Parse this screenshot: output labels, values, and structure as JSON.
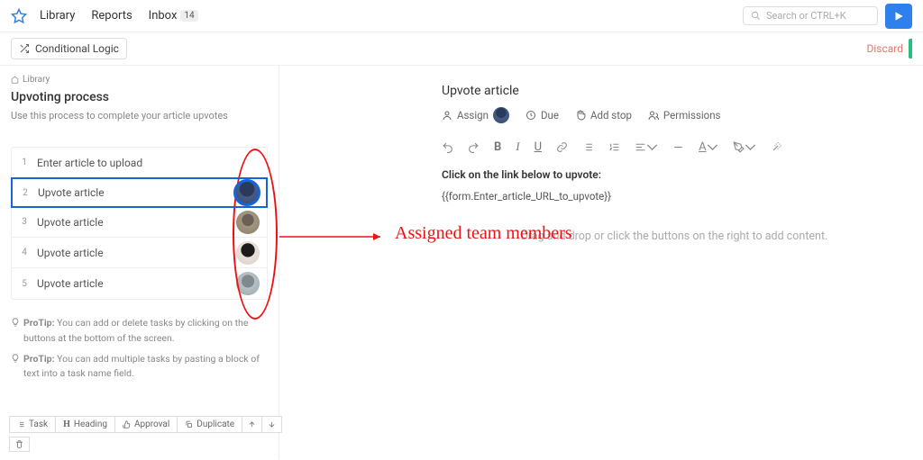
{
  "nav": {
    "items": [
      "Library",
      "Reports",
      "Inbox"
    ],
    "inbox_badge": "14",
    "search_placeholder": "Search or CTRL+K"
  },
  "toolbar": {
    "conditional_logic": "Conditional Logic",
    "discard": "Discard"
  },
  "breadcrumb": {
    "root": "Library"
  },
  "process": {
    "title": "Upvoting process",
    "subtitle": "Use this process to complete your article upvotes"
  },
  "tasks": [
    {
      "num": "1",
      "name": "Enter article to upload",
      "avatar": ""
    },
    {
      "num": "2",
      "name": "Upvote article",
      "avatar": "a1",
      "selected": true
    },
    {
      "num": "3",
      "name": "Upvote article",
      "avatar": "a2"
    },
    {
      "num": "4",
      "name": "Upvote article",
      "avatar": "a3"
    },
    {
      "num": "5",
      "name": "Upvote article",
      "avatar": "a4"
    }
  ],
  "tips": {
    "label": "ProTip:",
    "t1": "You can add or delete tasks by clicking on the buttons at the bottom of the screen.",
    "t2": "You can add multiple tasks by pasting a block of text into a task name field."
  },
  "bottom_buttons": {
    "task": "Task",
    "heading": "Heading",
    "approval": "Approval",
    "duplicate": "Duplicate"
  },
  "detail": {
    "title": "Upvote article",
    "assign": "Assign",
    "due": "Due",
    "add_stop": "Add stop",
    "permissions": "Permissions",
    "body_heading": "Click on the link below to upvote:",
    "body_template": "{{form.Enter_article_URL_to_upvote}}",
    "placeholder": "Drag and drop or click the buttons on the right to add content."
  },
  "annotation": {
    "label": "Assigned team members"
  }
}
